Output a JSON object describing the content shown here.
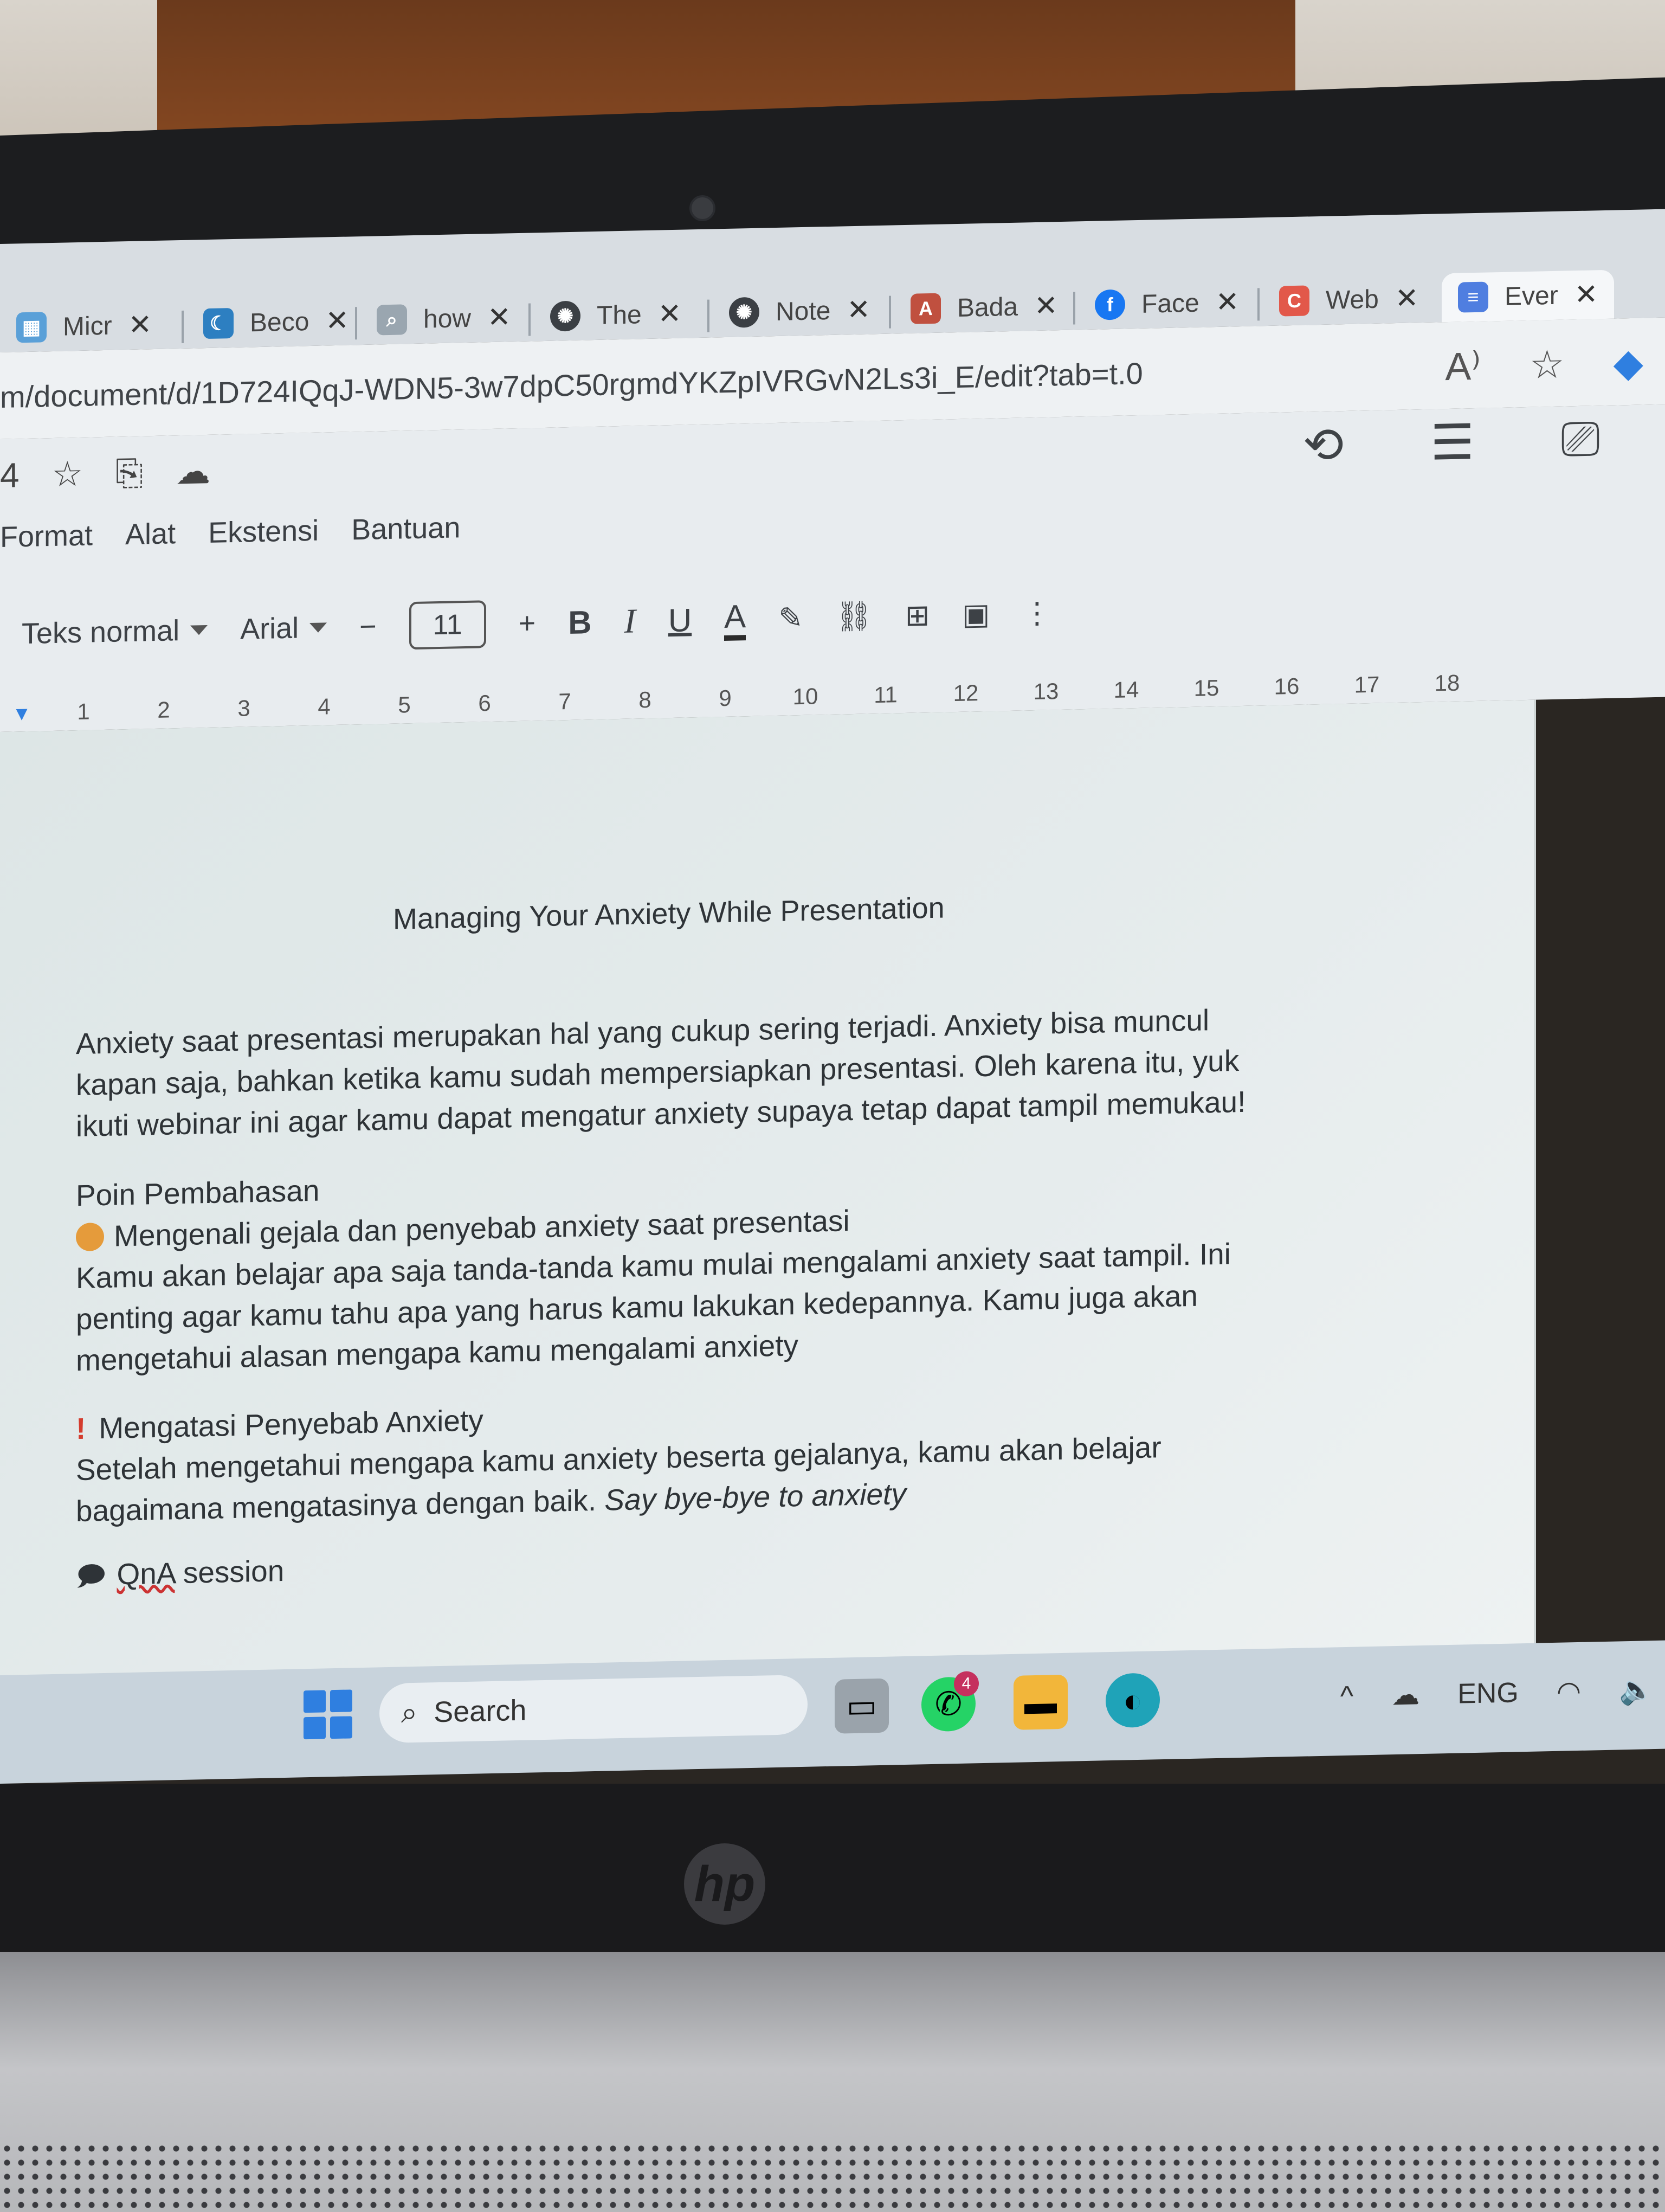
{
  "tabs": [
    {
      "label": "Micr",
      "icon": "microsoft-icon",
      "color": "#5aa0d8"
    },
    {
      "label": "Beco",
      "icon": "moon-icon",
      "color": "#2d7fc1"
    },
    {
      "label": "how",
      "icon": "search-icon",
      "color": "#6b7a88"
    },
    {
      "label": "The",
      "icon": "openai-icon",
      "color": "#3b3f44"
    },
    {
      "label": "Note",
      "icon": "openai-icon",
      "color": "#3b3f44"
    },
    {
      "label": "Bada",
      "icon": "kbbi-icon",
      "color": "#c0503f"
    },
    {
      "label": "Face",
      "icon": "facebook-icon",
      "color": "#1877f2"
    },
    {
      "label": "Web",
      "icon": "web-icon",
      "color": "#e2584a"
    },
    {
      "label": "Ever",
      "icon": "docs-icon",
      "color": "#4f7ee0"
    }
  ],
  "address": {
    "url": "m/document/d/1D724IQqJ-WDN5-3w7dpC50rgmdYKZpIVRGvN2Ls3i_E/edit?tab=t.0"
  },
  "docs": {
    "title_fragment": "4",
    "menu": [
      "Format",
      "Alat",
      "Ekstensi",
      "Bantuan"
    ],
    "toolbar": {
      "style": "Teks normal",
      "font": "Arial",
      "size": "11",
      "minus": "−",
      "plus": "+",
      "bold": "B",
      "italic": "I",
      "underline": "U",
      "text_color": "A"
    },
    "ruler": [
      "1",
      "2",
      "3",
      "4",
      "5",
      "6",
      "7",
      "8",
      "9",
      "10",
      "11",
      "12",
      "13",
      "14",
      "15",
      "16",
      "17",
      "18"
    ]
  },
  "document": {
    "title": "Managing Your Anxiety While Presentation",
    "intro": [
      "Anxiety saat presentasi merupakan hal yang cukup sering terjadi. Anxiety bisa muncul",
      "kapan saja, bahkan ketika kamu sudah mempersiapkan presentasi. Oleh karena itu, yuk",
      "ikuti webinar ini agar kamu dapat mengatur anxiety supaya tetap dapat tampil memukau!"
    ],
    "section_heading": "Poin Pembahasan",
    "point1_title": "Mengenali gejala dan penyebab anxiety saat presentasi",
    "point1_body": [
      "Kamu akan belajar apa saja tanda-tanda kamu mulai mengalami anxiety saat tampil. Ini",
      "penting agar kamu tahu apa yang harus kamu lakukan kedepannya. Kamu juga akan",
      "mengetahui alasan mengapa kamu mengalami anxiety"
    ],
    "point2_title": "Mengatasi Penyebab Anxiety",
    "point2_body_1": "Setelah mengetahui mengapa kamu anxiety beserta gejalanya, kamu akan belajar",
    "point2_body_2": "bagaimana mengatasinya dengan baik.",
    "point2_body_italic": "Say bye-bye to anxiety",
    "point3_title_a": "QnA",
    "point3_title_b": "session"
  },
  "taskbar": {
    "search_label": "Search",
    "whatsapp_badge": "4",
    "language": "ENG"
  },
  "device": {
    "logo": "hp"
  }
}
